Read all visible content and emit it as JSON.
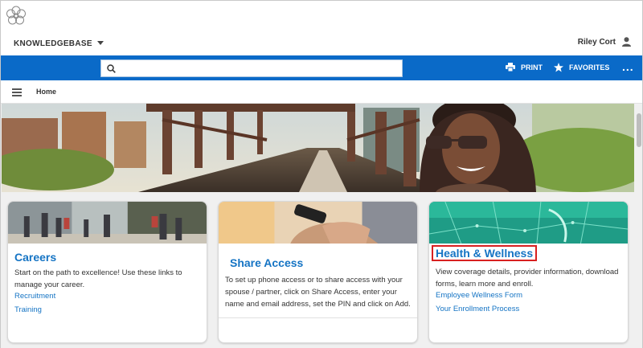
{
  "header": {
    "app_name": "KNOWLEDGEBASE",
    "user_name": "Riley Cort"
  },
  "search": {
    "placeholder": "",
    "value": ""
  },
  "actions": {
    "print_label": "PRINT",
    "favorites_label": "FAVORITES",
    "more_label": "..."
  },
  "nav": {
    "breadcrumb_home": "Home"
  },
  "cards": [
    {
      "title": "Careers",
      "description": "Start on the path to excellence! Use these links to manage your career.",
      "links": [
        "Recruitment",
        "Training"
      ]
    },
    {
      "title": "Share Access",
      "description": "To set up phone access or to share access with your spouse / partner, click on Share Access, enter your name and email address, set the PIN and click on Add.",
      "links": []
    },
    {
      "title": "Health & Wellness",
      "description": "View coverage details, provider information, download forms, learn more and enroll.",
      "links": [
        "Employee Wellness Form",
        "Your Enrollment Process"
      ]
    }
  ],
  "colors": {
    "brand_blue": "#0a6ac8",
    "link_blue": "#1574c4",
    "highlight_red": "#d82020"
  }
}
